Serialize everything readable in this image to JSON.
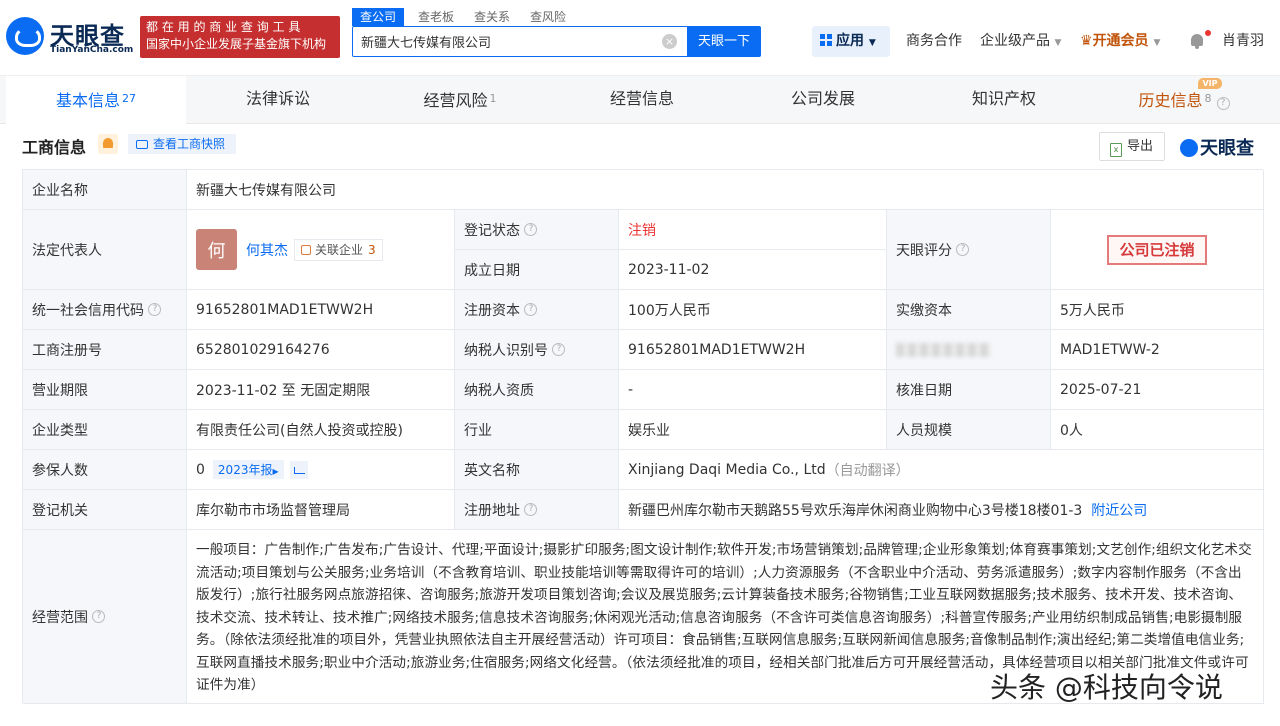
{
  "header": {
    "logo_text": "天眼查",
    "logo_sub": "TianYanCha.com",
    "slogan_line1": "都 在 用 的 商 业 查 询 工 具",
    "slogan_line2": "国家中小企业发展子基金旗下机构",
    "search_tabs": [
      "查公司",
      "查老板",
      "查关系",
      "查风险"
    ],
    "search_value": "新疆大七传媒有限公司",
    "search_button": "天眼一下",
    "nav_app": "应用",
    "nav_business": "商务合作",
    "nav_enterprise": "企业级产品",
    "nav_vip": "开通会员",
    "user_name": "肖青羽"
  },
  "tabs": [
    {
      "label": "基本信息",
      "count": "27"
    },
    {
      "label": "法律诉讼",
      "count": ""
    },
    {
      "label": "经营风险",
      "count": "1"
    },
    {
      "label": "经营信息",
      "count": ""
    },
    {
      "label": "公司发展",
      "count": ""
    },
    {
      "label": "知识产权",
      "count": ""
    },
    {
      "label": "历史信息",
      "count": "8"
    }
  ],
  "vip_badge": "VIP",
  "section": {
    "title": "工商信息",
    "snapshot": "查看工商快照",
    "export": "导出",
    "brand": "天眼查"
  },
  "info": {
    "company_name_label": "企业名称",
    "company_name": "新疆大七传媒有限公司",
    "legal_rep_label": "法定代表人",
    "legal_rep_avatar": "何",
    "legal_rep": "何其杰",
    "related_label": "关联企业",
    "related_count": "3",
    "reg_status_label": "登记状态",
    "reg_status": "注销",
    "found_date_label": "成立日期",
    "found_date": "2023-11-02",
    "score_label": "天眼评分",
    "score_stamp": "公司已注销",
    "credit_code_label": "统一社会信用代码",
    "credit_code": "91652801MAD1ETWW2H",
    "reg_capital_label": "注册资本",
    "reg_capital": "100万人民币",
    "paid_capital_label": "实缴资本",
    "paid_capital": "5万人民币",
    "reg_no_label": "工商注册号",
    "reg_no": "652801029164276",
    "taxpayer_id_label": "纳税人识别号",
    "taxpayer_id": "91652801MAD1ETWW2H",
    "org_code": "MAD1ETWW-2",
    "term_label": "营业期限",
    "term": "2023-11-02 至 无固定期限",
    "taxpayer_qual_label": "纳税人资质",
    "taxpayer_qual": "-",
    "approve_date_label": "核准日期",
    "approve_date": "2025-07-21",
    "type_label": "企业类型",
    "type": "有限责任公司(自然人投资或控股)",
    "industry_label": "行业",
    "industry": "娱乐业",
    "staff_label": "人员规模",
    "staff": "0人",
    "insured_label": "参保人数",
    "insured": "0",
    "insured_year": "2023年报",
    "english_label": "英文名称",
    "english": "Xinjiang Daqi Media Co., Ltd",
    "english_note": "（自动翻译）",
    "authority_label": "登记机关",
    "authority": "库尔勒市市场监督管理局",
    "address_label": "注册地址",
    "address": "新疆巴州库尔勒市天鹅路55号欢乐海岸休闲商业购物中心3号楼18楼01-3",
    "nearby": "附近公司",
    "scope_label": "经营范围",
    "scope": "一般项目：广告制作;广告发布;广告设计、代理;平面设计;摄影扩印服务;图文设计制作;软件开发;市场营销策划;品牌管理;企业形象策划;体育赛事策划;文艺创作;组织文化艺术交流活动;项目策划与公关服务;业务培训（不含教育培训、职业技能培训等需取得许可的培训）;人力资源服务（不含职业中介活动、劳务派遣服务）;数字内容制作服务（不含出版发行）;旅行社服务网点旅游招徕、咨询服务;旅游开发项目策划咨询;会议及展览服务;云计算装备技术服务;谷物销售;工业互联网数据服务;技术服务、技术开发、技术咨询、技术交流、技术转让、技术推广;网络技术服务;信息技术咨询服务;休闲观光活动;信息咨询服务（不含许可类信息咨询服务）;科普宣传服务;产业用纺织制成品销售;电影摄制服务。（除依法须经批准的项目外，凭营业执照依法自主开展经营活动）许可项目：食品销售;互联网信息服务;互联网新闻信息服务;音像制品制作;演出经纪;第二类增值电信业务;互联网直播技术服务;职业中介活动;旅游业务;住宿服务;网络文化经营。（依法须经批准的项目，经相关部门批准后方可开展经营活动，具体经营项目以相关部门批准文件或许可证件为准）"
  },
  "watermark": "头条 @科技向令说",
  "colors": {
    "accent": "#0a6cf2",
    "slogan_bg": "#c62f2f",
    "cancelled": "#e33333",
    "vip": "#c2540a"
  }
}
